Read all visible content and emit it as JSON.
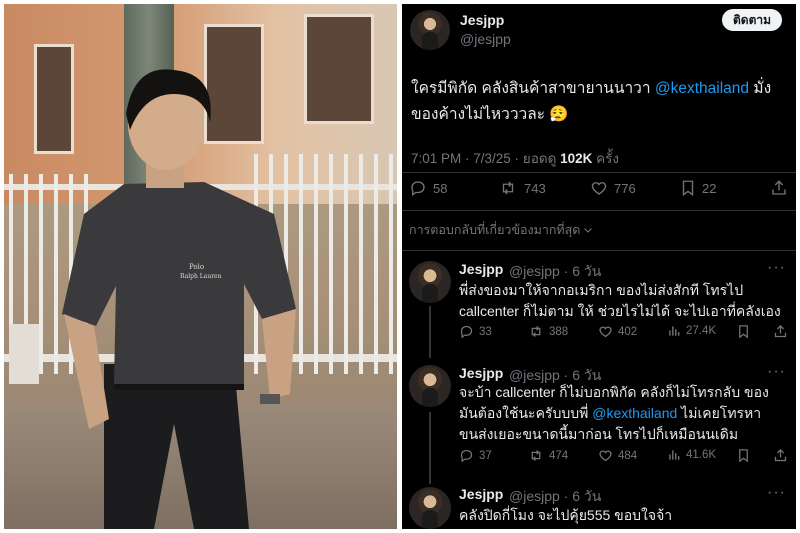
{
  "main_tweet": {
    "display_name": "Jesjpp",
    "handle": "@jesjpp",
    "follow_label": "ติดตาม",
    "text_part1": "ใครมีพิกัด คลังสินค้าสาขายานนาวา ",
    "mention": "@kexthailand",
    "text_part2": " มั่ง ของค้างไม่ไหวววละ 😮‍💨",
    "time": "7:01 PM · 7/3/25 · ยอดดู ",
    "views": "102K",
    "views_suffix": " ครั้ง",
    "replies": "58",
    "reposts": "743",
    "likes": "776",
    "bookmarks": "22"
  },
  "sort_label": "การตอบกลับที่เกี่ยวข้องมากที่สุด",
  "replies": [
    {
      "display_name": "Jesjpp",
      "handle_time": "@jesjpp · 6 วัน",
      "text": "พี่ส่งของมาให้จากอเมริกา ของไม่ส่งสักที โทรไป callcenter ก็ไม่ตาม ให้ ช่วยไรไม่ได้ จะไปเอาที่คลังเอง",
      "replies": "33",
      "reposts": "388",
      "likes": "402",
      "views": "27.4K"
    },
    {
      "display_name": "Jesjpp",
      "handle_time": "@jesjpp · 6 วัน",
      "text_part1": "จะบ้า callcenter ก็ไม่บอกพิกัด คลังก็ไม่โทรกลับ ของ มันต้องใช้นะครับบบพี่ ",
      "mention": "@kexthailand",
      "text_part2": " ไม่เคยโทรหา ขนส่งเยอะขนาดนี้มาก่อน โทรไปก็เหมือนนเดิม",
      "replies": "37",
      "reposts": "474",
      "likes": "484",
      "views": "41.6K"
    },
    {
      "display_name": "Jesjpp",
      "handle_time": "@jesjpp · 6 วัน",
      "text": "คลังปิดกี่โมง จะไปคุ้ย555 ขอบใจจ้า"
    }
  ],
  "colors": {
    "background": "#000000",
    "text": "#e7e9ea",
    "muted": "#71767b",
    "link": "#1d9bf0",
    "divider": "#2f3336"
  }
}
